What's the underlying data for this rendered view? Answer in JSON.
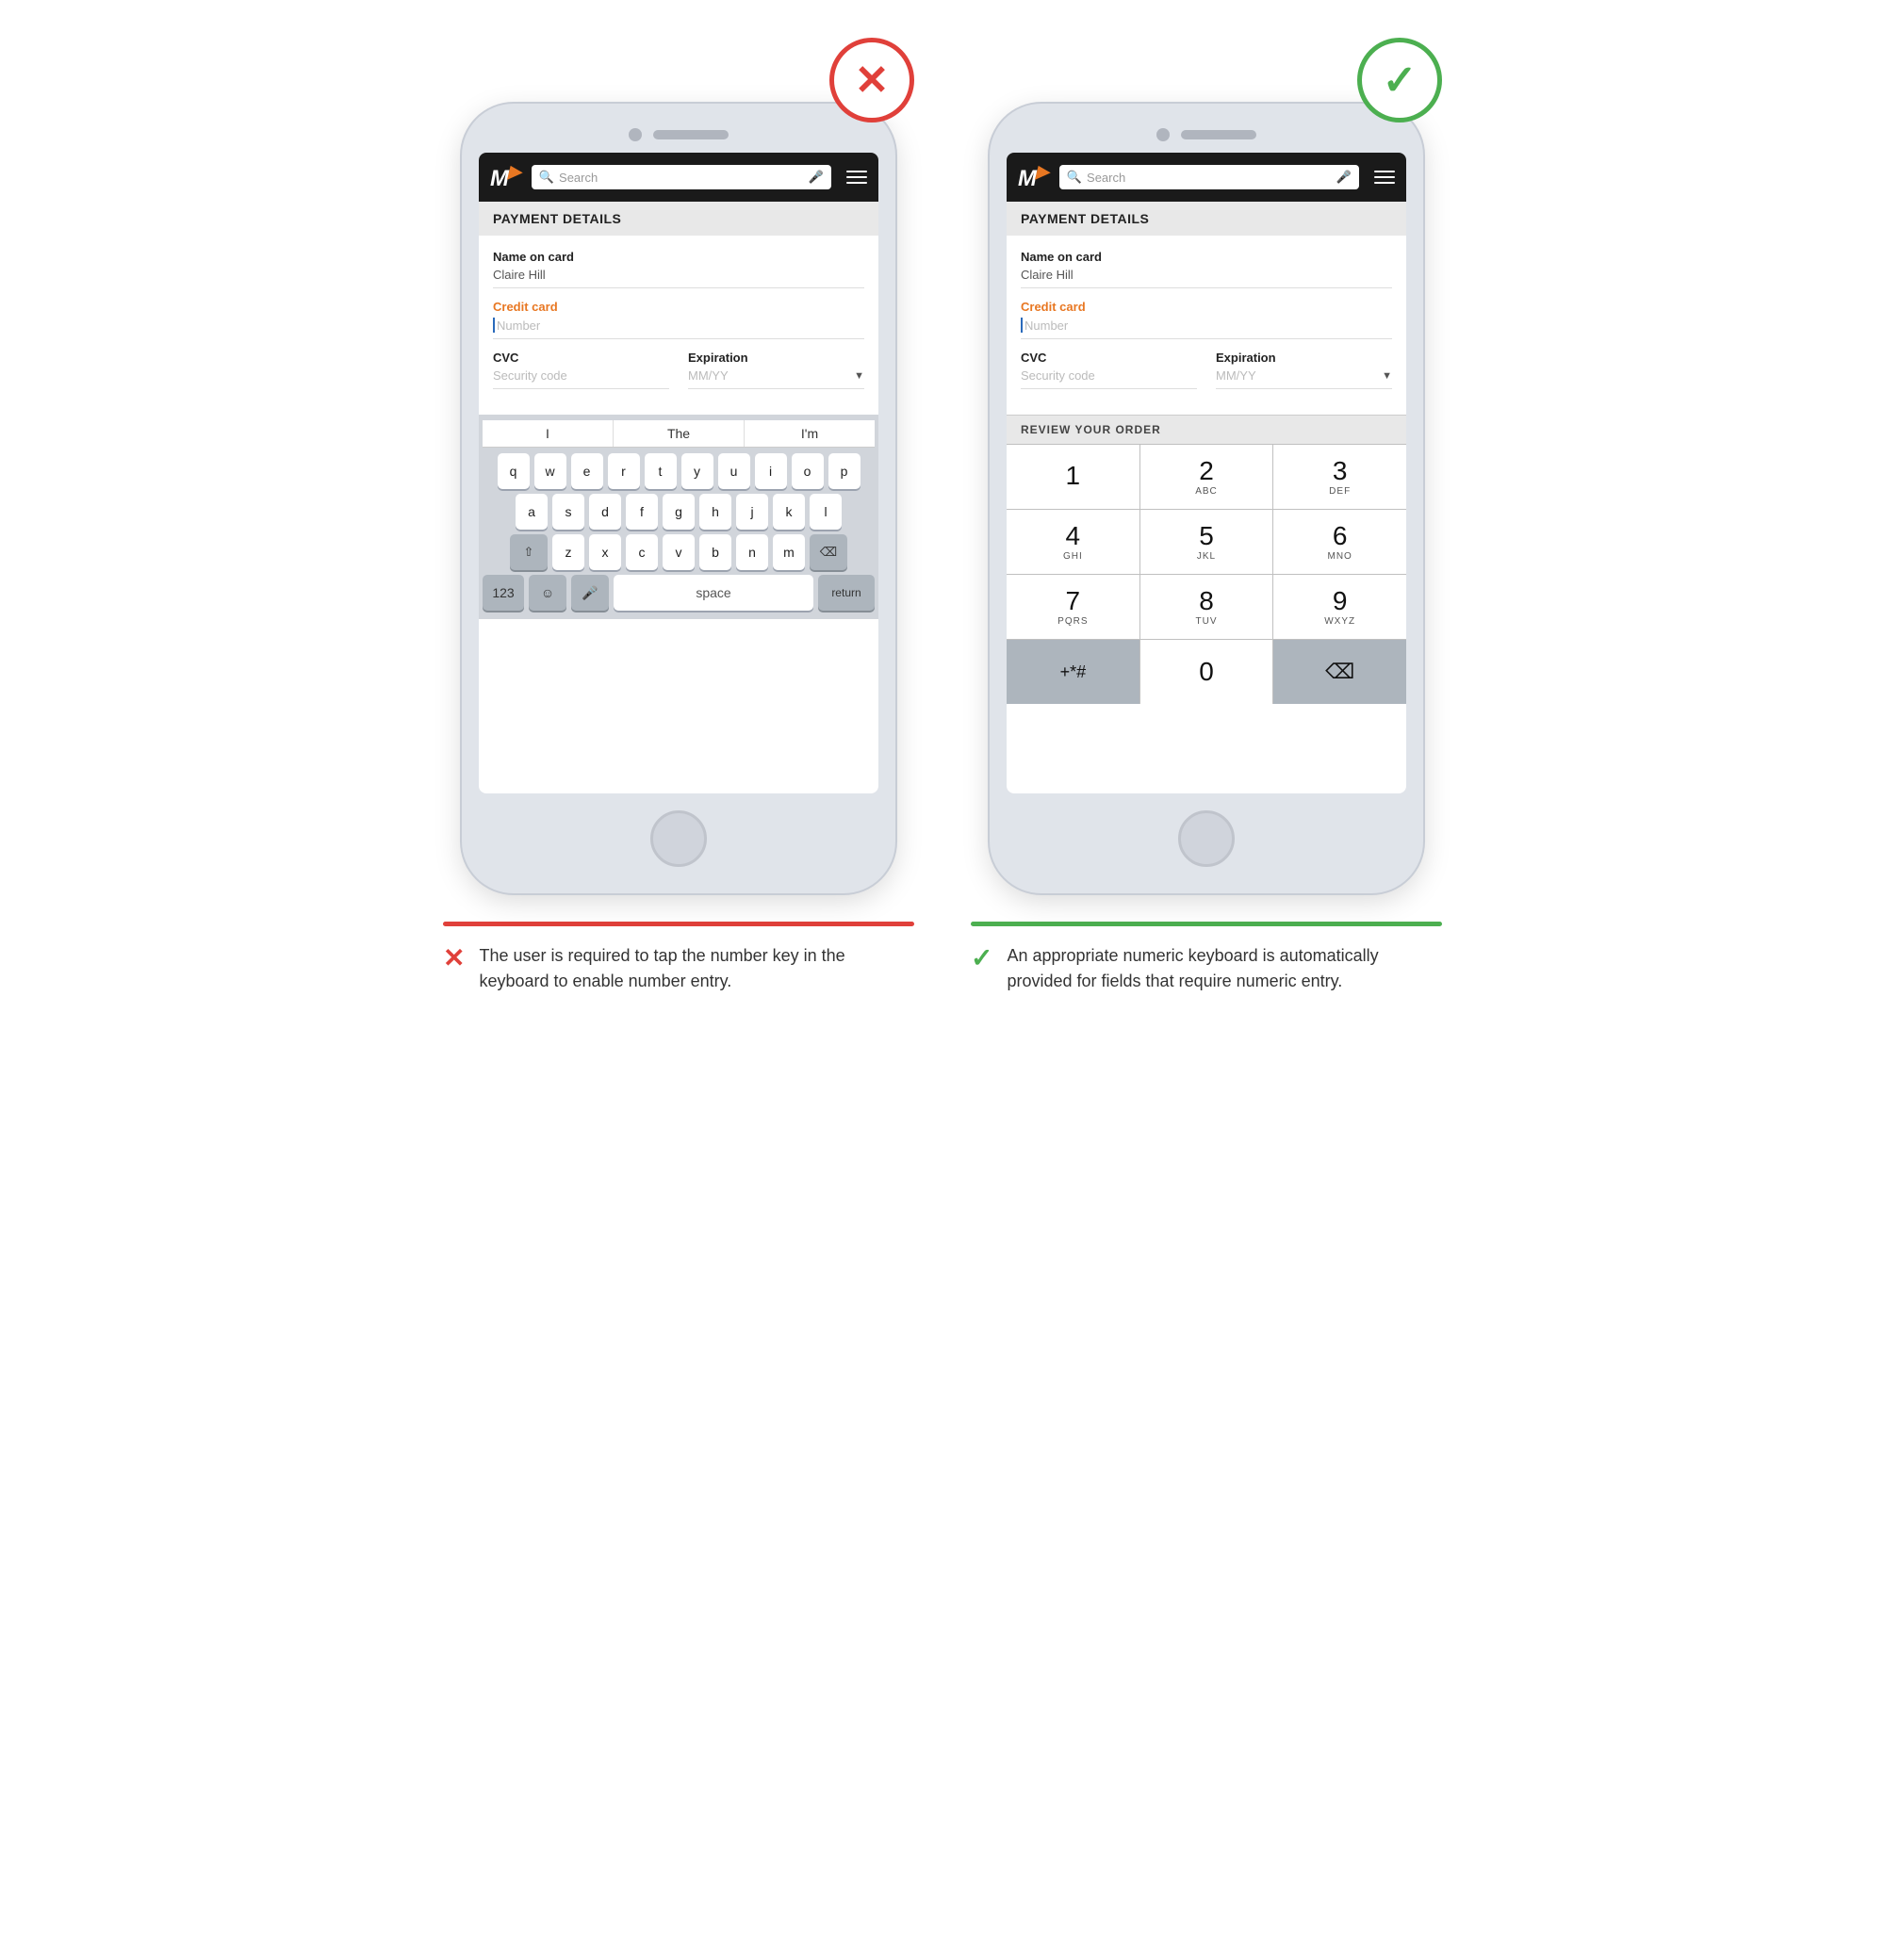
{
  "bad_example": {
    "badge": "✕",
    "badge_class": "badge-bad",
    "header": {
      "logo": "M",
      "search_placeholder": "Search",
      "mic_icon": "🎤",
      "menu_icon": "≡"
    },
    "section_title": "PAYMENT DETAILS",
    "form": {
      "name_label": "Name on card",
      "name_value": "Claire Hill",
      "credit_card_label": "Credit card",
      "credit_card_placeholder": "Number",
      "cvc_label": "CVC",
      "cvc_placeholder": "Security code",
      "expiration_label": "Expiration",
      "expiration_placeholder": "MM/YY"
    },
    "keyboard": {
      "suggestions": [
        "I",
        "The",
        "I'm"
      ],
      "row1": [
        "q",
        "w",
        "e",
        "r",
        "t",
        "y",
        "u",
        "i",
        "o",
        "p"
      ],
      "row2": [
        "a",
        "s",
        "d",
        "f",
        "g",
        "h",
        "j",
        "k",
        "l"
      ],
      "row3": [
        "z",
        "x",
        "c",
        "v",
        "b",
        "n",
        "m"
      ],
      "special_left": "⇧",
      "special_right": "⌫",
      "bottom_left": "123",
      "emoji": "☺",
      "mic": "🎤",
      "space": "space",
      "return": "return"
    },
    "caption_line_class": "caption-line-red",
    "caption_badge": "✕",
    "caption_badge_color": "#e0403a",
    "caption_text": "The user is required to tap the number key in the keyboard to enable number entry."
  },
  "good_example": {
    "badge": "✓",
    "badge_class": "badge-good",
    "header": {
      "logo": "M",
      "search_placeholder": "Search",
      "mic_icon": "🎤",
      "menu_icon": "≡"
    },
    "section_title": "PAYMENT DETAILS",
    "form": {
      "name_label": "Name on card",
      "name_value": "Claire Hill",
      "credit_card_label": "Credit card",
      "credit_card_placeholder": "Number",
      "cvc_label": "CVC",
      "cvc_placeholder": "Security code",
      "expiration_label": "Expiration",
      "expiration_placeholder": "MM/YY"
    },
    "review_section_title": "REVIEW YOUR ORDER",
    "numpad": {
      "rows": [
        [
          {
            "digit": "1",
            "letters": ""
          },
          {
            "digit": "2",
            "letters": "ABC"
          },
          {
            "digit": "3",
            "letters": "DEF"
          }
        ],
        [
          {
            "digit": "4",
            "letters": "GHI"
          },
          {
            "digit": "5",
            "letters": "JKL"
          },
          {
            "digit": "6",
            "letters": "MNO"
          }
        ],
        [
          {
            "digit": "7",
            "letters": "PQRS"
          },
          {
            "digit": "8",
            "letters": "TUV"
          },
          {
            "digit": "9",
            "letters": "WXYZ"
          }
        ],
        [
          {
            "digit": "+*#",
            "letters": "",
            "dark": true
          },
          {
            "digit": "0",
            "letters": ""
          },
          {
            "digit": "⌫",
            "letters": "",
            "dark": true
          }
        ]
      ]
    },
    "caption_line_class": "caption-line-green",
    "caption_badge": "✓",
    "caption_badge_color": "#4caf50",
    "caption_text": "An appropriate numeric keyboard is automatically provided for fields that require numeric entry."
  }
}
